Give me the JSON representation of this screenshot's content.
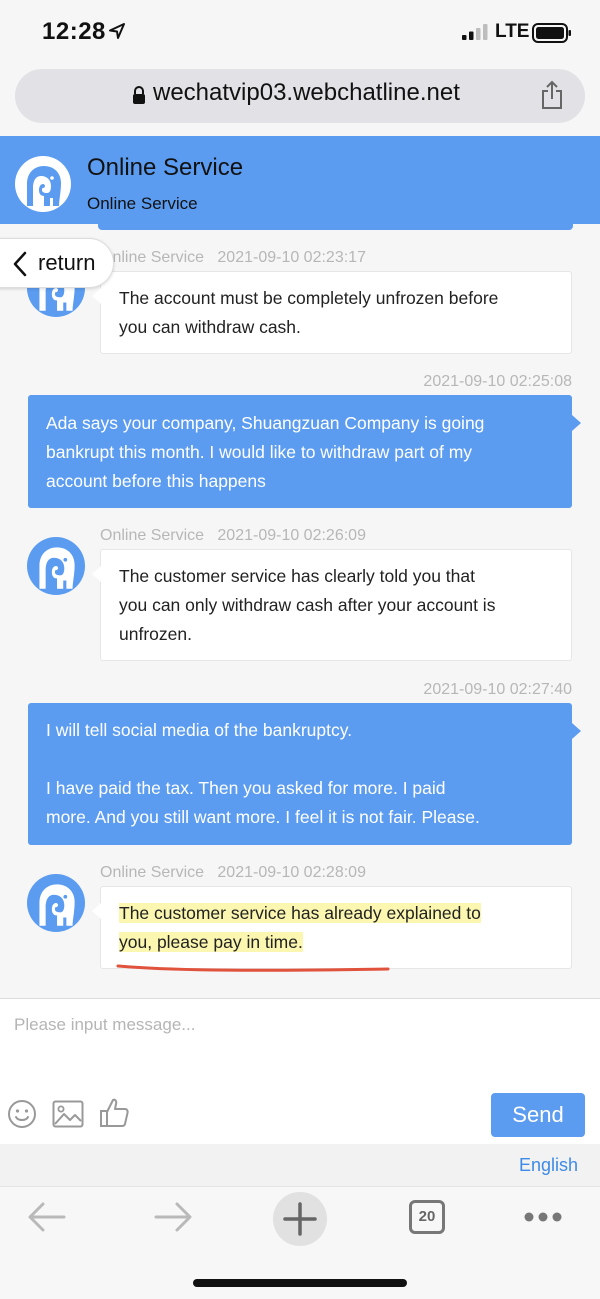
{
  "status_bar": {
    "time": "12:28",
    "network": "LTE"
  },
  "browser": {
    "url": "wechatvip03.webchatline.net",
    "tab_count": "20"
  },
  "header": {
    "title": "Online Service",
    "subtitle": "Online Service"
  },
  "return_label": "return",
  "messages": [
    {
      "from": "agent",
      "sender": "Online Service",
      "time": "2021-09-10 02:23:17",
      "lines": [
        "The account must be completely unfrozen before",
        "you can withdraw cash."
      ]
    },
    {
      "from": "user",
      "time": "2021-09-10 02:25:08",
      "lines": [
        "Ada says your company, Shuangzuan Company is going",
        "bankrupt this month. I would like to withdraw part of my",
        "account before this happens"
      ]
    },
    {
      "from": "agent",
      "sender": "Online Service",
      "time": "2021-09-10 02:26:09",
      "lines": [
        "The customer service has clearly told you that",
        "you can only withdraw cash after your account is",
        "unfrozen."
      ]
    },
    {
      "from": "user",
      "time": "2021-09-10 02:27:40",
      "lines": [
        "I will tell social media of the bankruptcy.",
        "",
        "I have paid the tax. Then you asked for more. I paid",
        "more. And you still want more. I feel it is not fair. Please."
      ]
    },
    {
      "from": "agent",
      "sender": "Online Service",
      "time": "2021-09-10 02:28:09",
      "lines": [
        "The customer service has already explained to",
        "you, please pay in time."
      ]
    }
  ],
  "input": {
    "placeholder": "Please input message...",
    "send_label": "Send",
    "language": "English"
  },
  "icons": [
    "location-arrow-icon",
    "signal-icon",
    "battery-icon",
    "lock-icon",
    "share-icon",
    "elephant-icon",
    "chevron-left-icon",
    "smiley-icon",
    "image-icon",
    "thumbs-up-icon",
    "back-arrow-icon",
    "forward-arrow-icon",
    "plus-icon",
    "tabs-icon",
    "more-icon"
  ],
  "colors": {
    "accent": "#5b9cf0",
    "link": "#3d8ae8",
    "highlight": "#fbf6b0",
    "underline": "#e0523c"
  }
}
